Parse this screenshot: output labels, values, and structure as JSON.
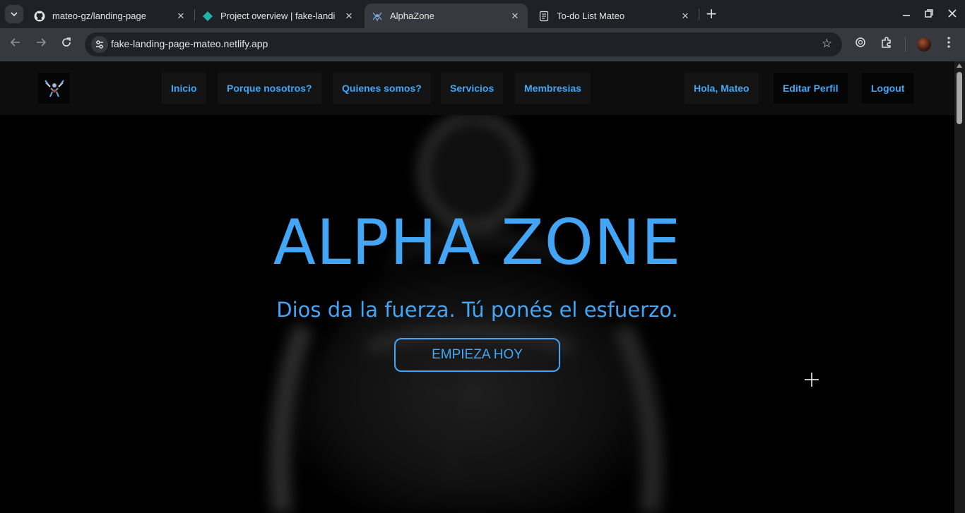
{
  "browser": {
    "tabs": [
      {
        "title": "mateo-gz/landing-page",
        "favicon": "github-icon",
        "active": false
      },
      {
        "title": "Project overview | fake-landi",
        "favicon": "netlify-icon",
        "active": false
      },
      {
        "title": "AlphaZone",
        "favicon": "alphazone-icon",
        "active": true
      },
      {
        "title": "To-do List Mateo",
        "favicon": "document-icon",
        "active": false
      }
    ],
    "url": "fake-landing-page-mateo.netlify.app"
  },
  "site": {
    "nav": {
      "links": [
        "Inicio",
        "Porque nosotros?",
        "Quienes somos?",
        "Servicios",
        "Membresias"
      ],
      "greeting": "Hola, Mateo",
      "edit_profile": "Editar Perfil",
      "logout": "Logout"
    },
    "hero": {
      "title": "ALPHA ZONE",
      "subtitle": "Dios da la fuerza. Tú ponés el esfuerzo.",
      "cta": "EMPIEZA HOY"
    }
  },
  "colors": {
    "accent": "#42a5f5",
    "background": "#000000",
    "nav_background": "#0d0d0d"
  }
}
